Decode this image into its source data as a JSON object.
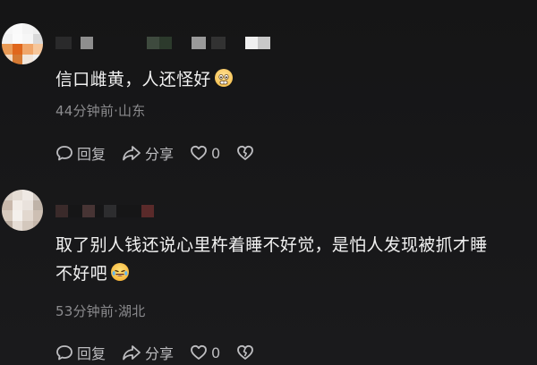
{
  "comments": [
    {
      "text": "信口雌黄，人还怪好",
      "emoji": "grimace-emoji",
      "time_location": "44分钟前·山东",
      "actions": {
        "reply_label": "回复",
        "share_label": "分享",
        "like_count": "0"
      }
    },
    {
      "text_line1": "取了别人钱还说心里杵着睡不好觉，是怕人发现被抓才睡",
      "text_line2": "不好吧",
      "emoji": "laughing-tears-emoji",
      "time_location": "53分钟前·湖北",
      "actions": {
        "reply_label": "回复",
        "share_label": "分享",
        "like_count": "0"
      }
    }
  ],
  "colors": {
    "background": "#161617",
    "text": "#f1f1f1",
    "meta": "#8b8b8e",
    "action": "#bdbdc0"
  }
}
